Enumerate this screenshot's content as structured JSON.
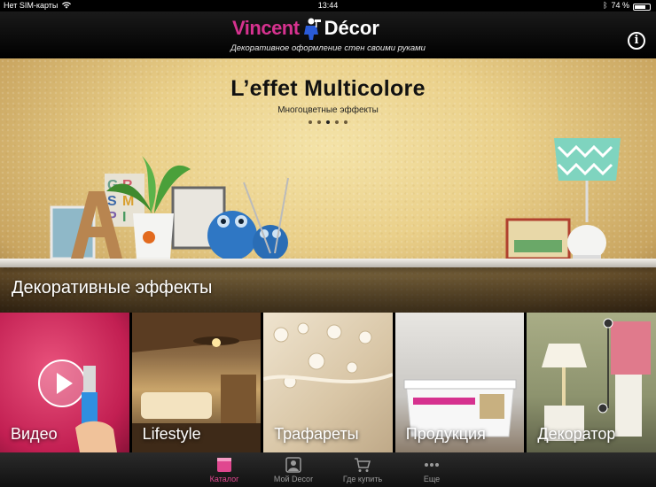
{
  "status_bar": {
    "carrier": "Нет SIM-карты",
    "time": "13:44",
    "battery": "74 %",
    "battery_level": 0.74
  },
  "header": {
    "logo_left": "Vincent",
    "logo_right": "Décor",
    "tagline": "Декоративное оформление стен своими руками",
    "info_icon": "info-icon"
  },
  "hero": {
    "title": "L’effet Multicolore",
    "subtitle": "Многоцветные эффекты",
    "page_count": 5,
    "active_page": 2
  },
  "section": {
    "title": "Декоративные эффекты"
  },
  "tiles": [
    {
      "label": "Видео",
      "icon": "play-icon"
    },
    {
      "label": "Lifestyle"
    },
    {
      "label": "Трафареты"
    },
    {
      "label": "Продукция"
    },
    {
      "label": "Декоратор"
    }
  ],
  "tabbar": {
    "items": [
      {
        "label": "Каталог",
        "icon": "catalog-icon",
        "active": true
      },
      {
        "label": "Мой Decor",
        "icon": "profile-icon",
        "active": false
      },
      {
        "label": "Где купить",
        "icon": "cart-icon",
        "active": false
      },
      {
        "label": "Еще",
        "icon": "more-icon",
        "active": false
      }
    ]
  },
  "colors": {
    "brand_pink": "#d6328f",
    "active_tab": "#e0478f"
  }
}
